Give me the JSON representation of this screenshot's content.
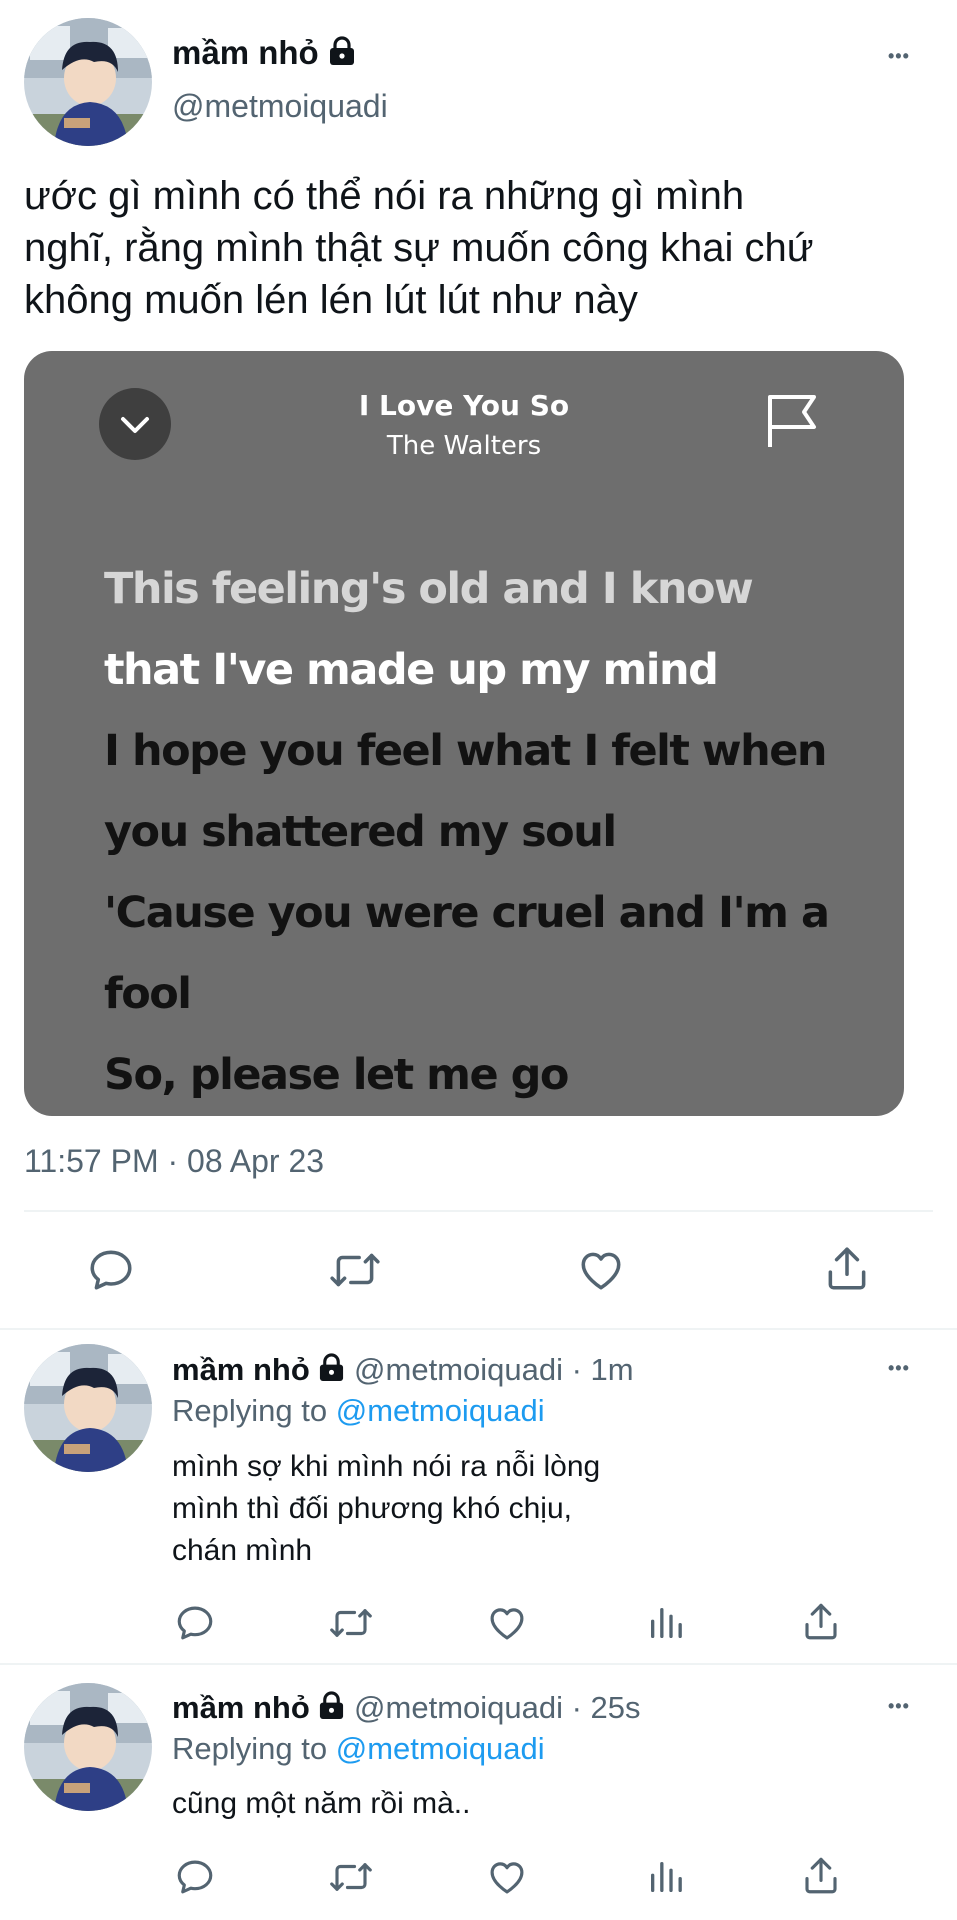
{
  "tweet": {
    "name": "mầm nhỏ",
    "handle": "@metmoiquadi",
    "more": "•••",
    "text_lines": [
      "ước gì mình có thể nói ra những gì mình",
      "nghĩ, rằng mình thật sự muốn công khai chứ",
      "không muốn lén lén lút lút như này"
    ],
    "timestamp": "11:57 PM · 08 Apr 23"
  },
  "card": {
    "song_title": "I Love You So",
    "artist": "The Walters",
    "lyrics": [
      {
        "text": "This feeling's old and I know",
        "state": "past"
      },
      {
        "text": "that I've made up my mind",
        "state": "current"
      },
      {
        "text": "I hope you feel what I felt when",
        "state": "upcoming"
      },
      {
        "text": "you shattered my soul",
        "state": "upcoming"
      },
      {
        "text": "'Cause you were cruel and I'm a",
        "state": "upcoming"
      },
      {
        "text": "fool",
        "state": "upcoming"
      },
      {
        "text": "So, please let me go",
        "state": "upcoming"
      }
    ],
    "colors": {
      "background": "#6e6e6e",
      "past": "#d6d6d6",
      "current": "#ffffff",
      "upcoming": "#121212"
    }
  },
  "replies": [
    {
      "name": "mầm nhỏ",
      "handle": "@metmoiquadi",
      "time": "· 1m",
      "replying_prefix": "Replying to",
      "replying_handle": "@metmoiquadi",
      "text_lines": [
        "mình sợ khi mình nói ra nỗi lòng",
        "mình thì đối phương khó chịu,",
        "chán mình"
      ],
      "more": "•••"
    },
    {
      "name": "mầm nhỏ",
      "handle": "@metmoiquadi",
      "time": "· 25s",
      "replying_prefix": "Replying to",
      "replying_handle": "@metmoiquadi",
      "text_lines": [
        "cũng một năm rồi mà.."
      ],
      "more": "•••"
    }
  ],
  "colors": {
    "accent": "#1d9bf0",
    "muted": "#536471",
    "divider": "#eff3f4"
  }
}
